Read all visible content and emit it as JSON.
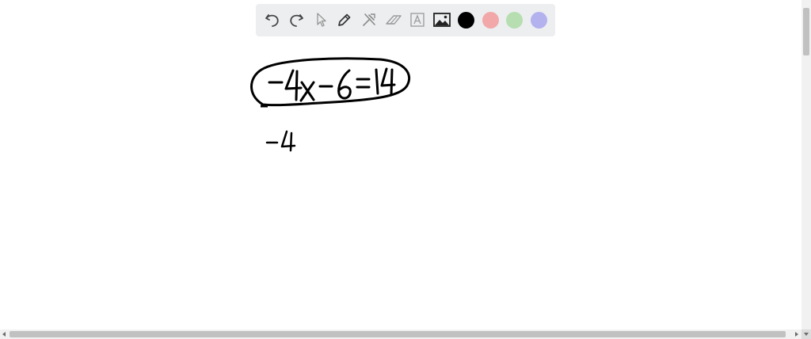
{
  "toolbar": {
    "tools": [
      {
        "name": "undo-icon"
      },
      {
        "name": "redo-icon"
      },
      {
        "name": "select-arrow-icon"
      },
      {
        "name": "pen-icon"
      },
      {
        "name": "tools-icon"
      },
      {
        "name": "eraser-icon"
      },
      {
        "name": "text-tool-icon"
      },
      {
        "name": "image-icon"
      }
    ],
    "colors": {
      "black": "#000000",
      "red": "#f2a7a9",
      "green": "#b6deb0",
      "blue": "#b3b1ee"
    }
  },
  "canvas": {
    "strokes": [
      {
        "name": "equation-handwriting",
        "text": "-4x-6=14"
      },
      {
        "name": "step-handwriting",
        "text": "-4"
      }
    ],
    "ink_color": "#000000"
  }
}
